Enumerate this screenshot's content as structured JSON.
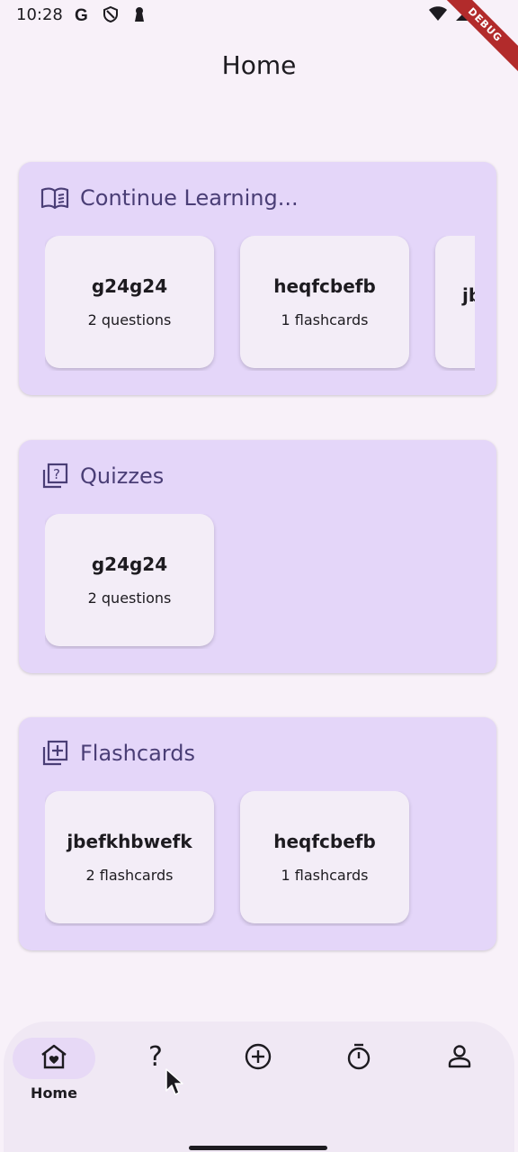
{
  "status_bar": {
    "time": "10:28",
    "debug_label": "DEBUG"
  },
  "app_bar": {
    "title": "Home"
  },
  "sections": {
    "continue": {
      "title": "Continue Learning...",
      "icon": "open-book-icon",
      "cards": [
        {
          "title": "g24g24",
          "subtitle": "2 questions"
        },
        {
          "title": "heqfcbefb",
          "subtitle": "1 flashcards"
        },
        {
          "title": "jb",
          "subtitle": ""
        }
      ]
    },
    "quizzes": {
      "title": "Quizzes",
      "icon": "quiz-icon",
      "cards": [
        {
          "title": "g24g24",
          "subtitle": "2 questions"
        }
      ]
    },
    "flashcards": {
      "title": "Flashcards",
      "icon": "add-library-icon",
      "cards": [
        {
          "title": "jbefkhbwefk",
          "subtitle": "2 flashcards"
        },
        {
          "title": "heqfcbefb",
          "subtitle": "1 flashcards"
        }
      ]
    }
  },
  "bottom_nav": {
    "items": [
      {
        "label": "Home",
        "icon": "home-heart-icon",
        "active": true
      },
      {
        "label": "",
        "icon": "question-mark-icon",
        "active": false
      },
      {
        "label": "",
        "icon": "add-circle-icon",
        "active": false
      },
      {
        "label": "",
        "icon": "timer-icon",
        "active": false
      },
      {
        "label": "",
        "icon": "person-icon",
        "active": false
      }
    ]
  },
  "colors": {
    "background": "#f8f1f9",
    "section_bg": "#e4d6f9",
    "card_bg": "#f3edf7",
    "accent_text": "#4a3e76",
    "nav_indicator": "#e7d9f6"
  }
}
